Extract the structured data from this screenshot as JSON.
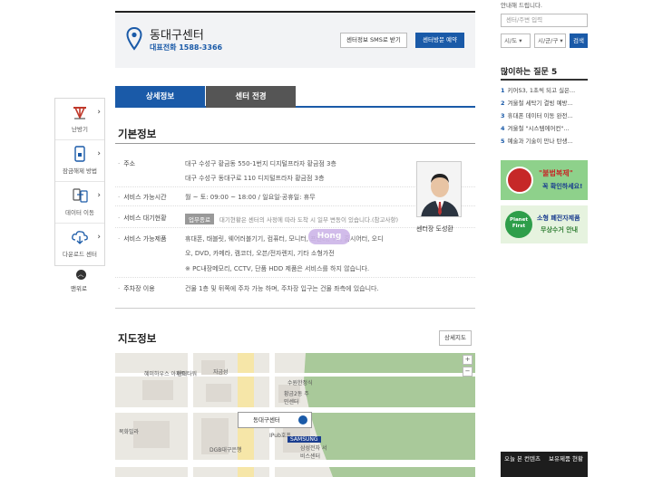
{
  "quick_menu": {
    "items": [
      {
        "label": "난방기",
        "icon": "heater-icon"
      },
      {
        "label": "잠금해제 방법",
        "icon": "unlock-icon"
      },
      {
        "label": "데이터 이동",
        "icon": "data-transfer-icon"
      },
      {
        "label": "다운로드 센터",
        "icon": "download-cloud-icon"
      }
    ],
    "top_label": "맨위로"
  },
  "center": {
    "name": "동대구센터",
    "tel_label": "대표전화 1588-3366",
    "sms_button": "센터정보 SMS로 받기",
    "visit_button": "센터방문 예약"
  },
  "tabs": [
    {
      "label": "상세정보",
      "active": true
    },
    {
      "label": "센터 전경",
      "active": false
    }
  ],
  "basic_info": {
    "title": "기본정보",
    "address_label": "주소",
    "address_line1": "대구 수성구 황금동 550-1번지 디지털프라자 황금점 3층",
    "address_line2": "대구 수성구 동대구로 110 디지털프라자 황금점 3층",
    "hours_label": "서비스 가능시간",
    "hours_value": "월 ~ 토: 09:00 ~ 18:00 / 일요일·공휴일: 휴무",
    "wait_label": "서비스 대기현황",
    "wait_badge": "업무종료",
    "wait_note": "대기현황은 센터의 사정에 따라 도착 시 일부 변동이 있습니다.(참고사항)",
    "products_label": "서비스 가능제품",
    "products_line1": "휴대폰, 태블릿, 웨어러블기기, 컴퓨터, 모니터, 프린터, TV, 홈시어터, 오디",
    "products_line2": "오, DVD, 카메라, 캠코더, 오븐/전자렌지, 기타 소형가전",
    "products_line3": "※ PC내장메모리, CCTV, 단품 HDD 제품은 서비스를 하지 않습니다.",
    "parking_label": "주차장 이용",
    "parking_value": "건물 1층 및 뒤쪽에 주차 가능 하며, 주차장 입구는 건물 좌측에 있습니다.",
    "manager_label": "센터장 도성환",
    "watermark": "Hong"
  },
  "map_section": {
    "title": "지도정보",
    "detail_button": "상세지도",
    "marker_label": "동대구센터",
    "place_labels": [
      "혜미하우스 아파트",
      "현대타워",
      "자금성",
      "수원한정식",
      "황금2동 주민센터",
      "삼성전자 서비스센터",
      "목화빌라",
      "DGB대구은행",
      "IPub호프",
      "SAMSUNG"
    ]
  },
  "sidebar": {
    "guide_text": "안내해 드립니다.",
    "search_placeholder": "센터/주변 입력",
    "select_city": "시/도",
    "select_district": "시/군/구",
    "search_button": "검색",
    "faq_title": "많이하는 질문 5",
    "faq": [
      {
        "num": "1",
        "text": "키어S3, 1초씩 되고 실은..."
      },
      {
        "num": "2",
        "text": "겨울철 세탁기 결빙 예방..."
      },
      {
        "num": "3",
        "text": "휴대폰 데이터 이동 완전..."
      },
      {
        "num": "4",
        "text": "겨울철 \"시스템에어컨\"..."
      },
      {
        "num": "5",
        "text": "예술과 기술이 만나 탄생..."
      }
    ],
    "banner1_text": "\"불법복제\"",
    "banner1_sub": "꼭 확인하세요!",
    "banner2_brand": "Planet First",
    "banner2_line1": "소형 폐전자제품",
    "banner2_line2": "무상수거 안내",
    "bottom_tab1": "오늘 본 컨텐츠",
    "bottom_tab2": "보유제품 현황"
  },
  "colors": {
    "brand_blue": "#1a5aa8",
    "tab_inactive": "#555555"
  }
}
